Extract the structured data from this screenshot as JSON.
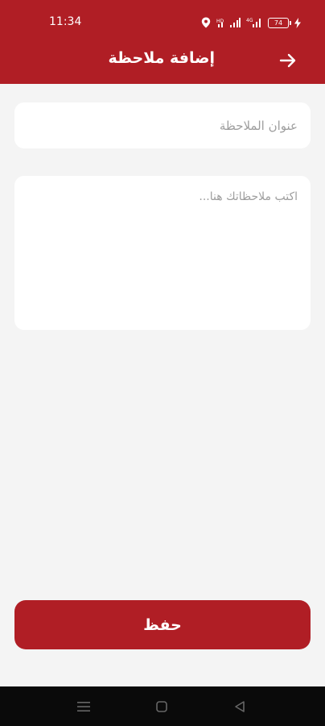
{
  "status_bar": {
    "time": "11:34",
    "battery": "74",
    "icons": [
      "location-icon",
      "signal-icon",
      "wifi-icon",
      "battery-icon",
      "charging-icon"
    ]
  },
  "app_bar": {
    "title": "إضافة ملاحظة",
    "back_icon": "arrow-right-icon"
  },
  "form": {
    "title_placeholder": "عنوان الملاحظة",
    "title_value": "",
    "notes_placeholder": "اكتب ملاحظاتك هنا...",
    "notes_value": ""
  },
  "save_button": {
    "label": "حفظ"
  },
  "nav_bar": {
    "buttons": [
      "menu-icon",
      "home-icon",
      "back-icon"
    ]
  },
  "colors": {
    "primary": "#b01e25",
    "background": "#f4f4f4",
    "card": "#ffffff",
    "placeholder": "#9e9e9e"
  }
}
